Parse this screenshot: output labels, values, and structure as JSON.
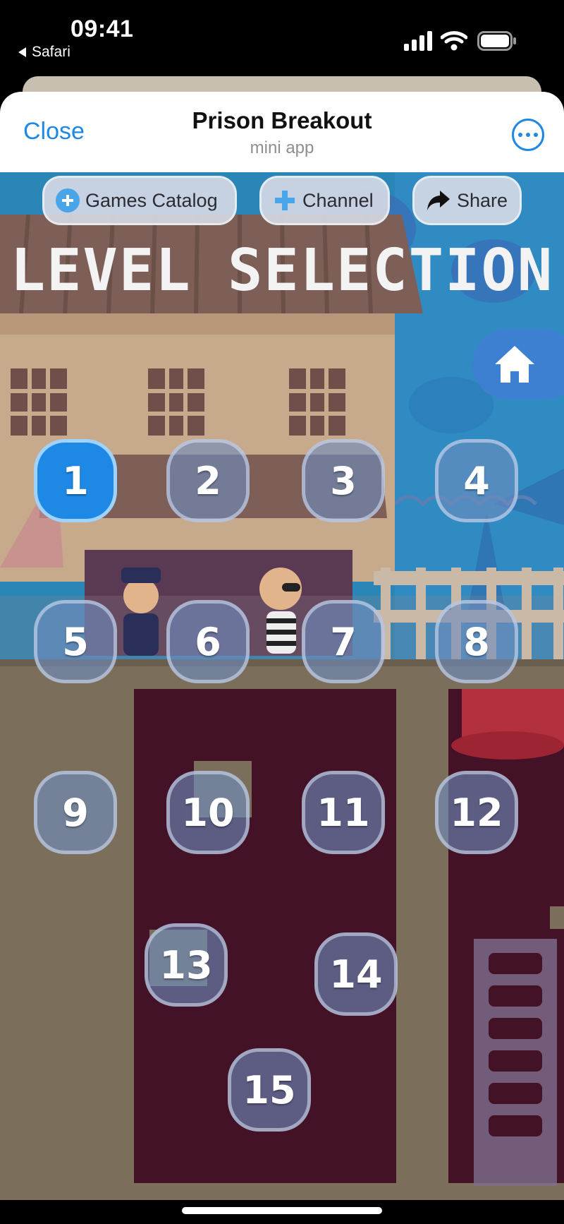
{
  "status_bar": {
    "time": "09:41",
    "back_app": "Safari"
  },
  "header": {
    "close_label": "Close",
    "title": "Prison Breakout",
    "subtitle": "mini app"
  },
  "game_nav": {
    "catalog_label": "Games Catalog",
    "channel_label": "Channel",
    "share_label": "Share"
  },
  "screen": {
    "title": "LEVEL SELECTION"
  },
  "levels": [
    "1",
    "2",
    "3",
    "4",
    "5",
    "6",
    "7",
    "8",
    "9",
    "10",
    "11",
    "12",
    "13",
    "14",
    "15"
  ],
  "selected_level": "1",
  "colors": {
    "accent": "#1e88e5",
    "active_level": "#1e88e5",
    "level_button": "#6e8cbe",
    "sky": "#2a86b6",
    "house_wall": "#c7a98b",
    "roof": "#7d5f58",
    "floor": "#7b6f5c",
    "interior": "#431227",
    "home_button": "#3d7fd1"
  },
  "icons": {
    "back": "triangle-left-icon",
    "signal": "signal-bars-icon",
    "wifi": "wifi-icon",
    "battery": "battery-icon",
    "more": "ellipsis-circle-icon",
    "catalog": "gamepad-icon",
    "channel": "gamepad-icon",
    "share": "share-arrow-icon",
    "home": "house-icon"
  }
}
